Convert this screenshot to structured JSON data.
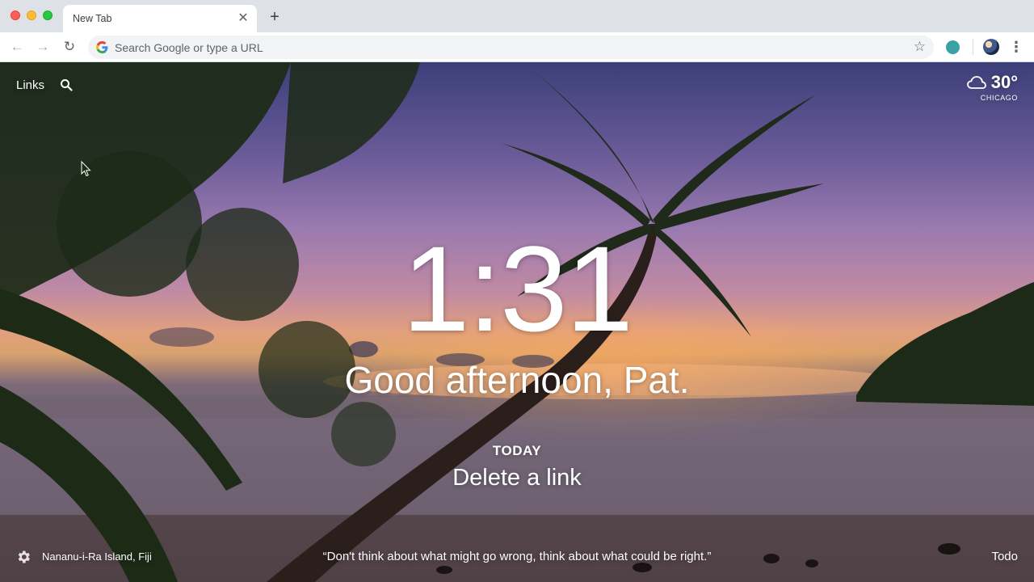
{
  "browser": {
    "tab_title": "New Tab",
    "tab_close_glyph": "✕",
    "new_tab_glyph": "+",
    "back_glyph": "←",
    "forward_glyph": "→",
    "reload_glyph": "↻",
    "omnibox_placeholder": "Search Google or type a URL",
    "bookmark_glyph": "☆",
    "menu_glyph": "⋮",
    "extension_color": "#3aa1a6"
  },
  "momentum": {
    "links_label": "Links",
    "weather": {
      "temperature": "30°",
      "city": "CHICAGO",
      "icon": "cloud-icon"
    },
    "clock": "1:31",
    "greeting": "Good afternoon, Pat.",
    "focus": {
      "label": "TODAY",
      "task": "Delete a link"
    },
    "photo_location": "Nananu-i-Ra Island, Fiji",
    "quote": "“Don't think about what might go wrong, think about what could be right.”",
    "todo_label": "Todo"
  }
}
